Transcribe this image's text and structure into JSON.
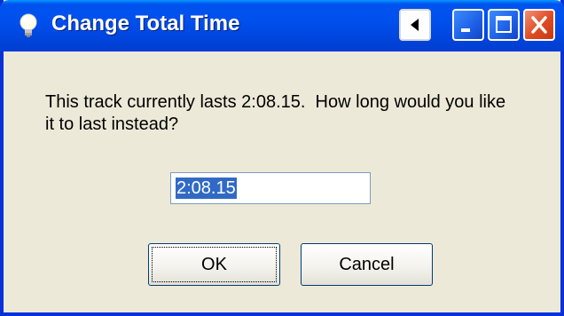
{
  "window": {
    "title": "Change Total Time",
    "colors": {
      "titlebar": "#0053ee",
      "dialog_bg": "#ece9d8",
      "close_button": "#de4b23",
      "selection": "#316ac5"
    },
    "controls": {
      "help_icon": "bulb-icon",
      "menu_icon": "triangle-left-icon",
      "minimize_icon": "minimize-icon",
      "maximize_icon": "maximize-icon",
      "close_icon": "close-icon"
    }
  },
  "dialog": {
    "message": "This track currently lasts 2:08.15.  How long would you like\nit to last instead?",
    "time_input": {
      "value": "2:08.15",
      "selected": true
    },
    "ok_label": "OK",
    "cancel_label": "Cancel"
  }
}
